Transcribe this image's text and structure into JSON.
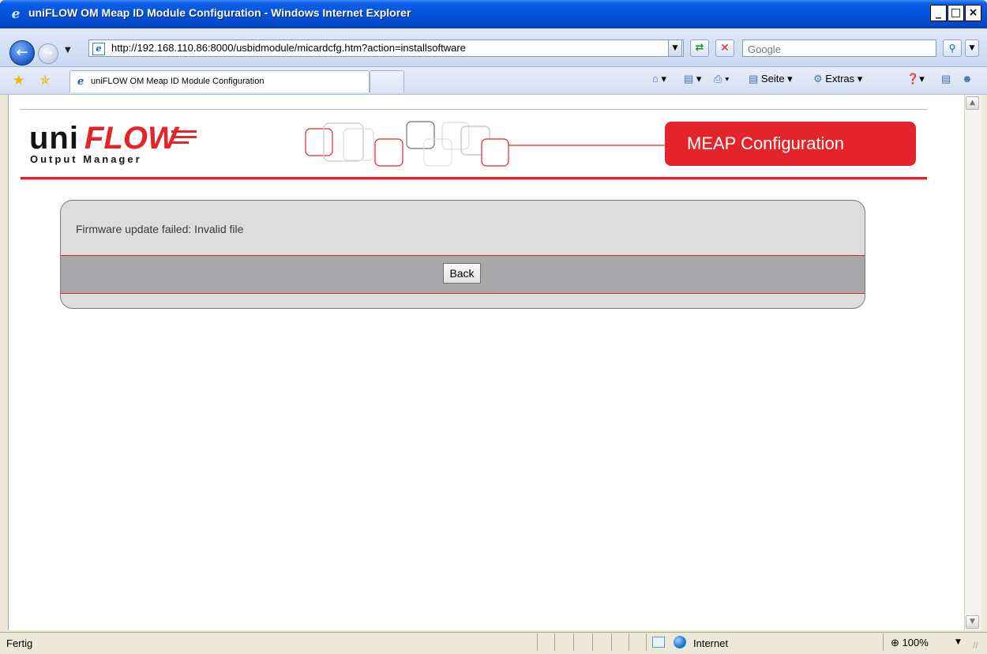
{
  "window": {
    "title": "uniFLOW OM Meap ID Module Configuration - Windows Internet Explorer",
    "minimize_glyph": "_",
    "maximize_glyph": "□",
    "close_glyph": "×"
  },
  "toolbar": {
    "address_url": "http://192.168.110.86:8000/usbidmodule/micardcfg.htm?action=installsoftware",
    "search_placeholder": "Google"
  },
  "tabs": [
    {
      "label": "uniFLOW OM Meap ID Module Configuration",
      "active": true
    }
  ],
  "command_bar": {
    "page_label": "Seite",
    "tools_label": "Extras"
  },
  "page": {
    "logo_uni": "uni",
    "logo_flow": "FLOW",
    "logo_subtitle": "Output Manager",
    "banner": "MEAP Configuration",
    "message": "Firmware update failed: Invalid file",
    "back_label": "Back",
    "accent_color": "#e3242b"
  },
  "statusbar": {
    "status": "Fertig",
    "zone": "Internet",
    "zoom": "100%"
  },
  "icons": [
    "ie-logo-icon",
    "back-arrow-icon",
    "forward-arrow-icon",
    "refresh-icon",
    "stop-icon",
    "search-icon",
    "favorites-star-icon",
    "add-favorites-icon",
    "home-icon",
    "feeds-icon",
    "print-icon",
    "page-icon",
    "tools-gear-icon",
    "help-icon",
    "research-icon",
    "messenger-icon",
    "globe-icon",
    "zoom-icon"
  ]
}
